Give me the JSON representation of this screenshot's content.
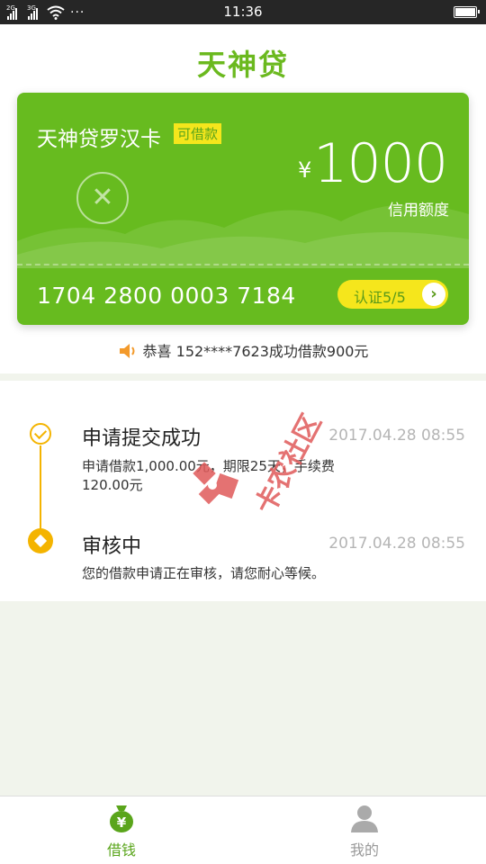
{
  "status_bar": {
    "signal1_tag": "2G",
    "signal2_tag": "3G",
    "more": "···",
    "time": "11:36"
  },
  "app": {
    "logo": "天神贷"
  },
  "card": {
    "name": "天神贷罗汉卡",
    "badge": "可借款",
    "currency": "¥",
    "amount": "1000",
    "limit_label": "信用额度",
    "number": "1704 2800 0003 7184",
    "verify_label": "认证5/5",
    "verify_arrow": "›",
    "colors": {
      "card": "#67bb1f",
      "badge": "#f5e61c"
    }
  },
  "notice": {
    "text": "恭喜 152****7623成功借款900元",
    "icon": "speaker-icon"
  },
  "timeline": [
    {
      "title": "申请提交成功",
      "time": "2017.04.28 08:55",
      "desc": "申请借款1,000.00元，期限25天，手续费120.00元",
      "icon": "check-circle-icon"
    },
    {
      "title": "审核中",
      "time": "2017.04.28 08:55",
      "desc": "您的借款申请正在审核，请您耐心等候。",
      "icon": "diamond-dot-icon"
    }
  ],
  "watermark": {
    "text": "卡农社区"
  },
  "bottom_nav": {
    "items": [
      {
        "label": "借钱",
        "icon": "money-bag-icon",
        "active": true
      },
      {
        "label": "我的",
        "icon": "user-icon",
        "active": false
      }
    ],
    "colors": {
      "active": "#5aa51b",
      "inactive": "#999999"
    }
  }
}
